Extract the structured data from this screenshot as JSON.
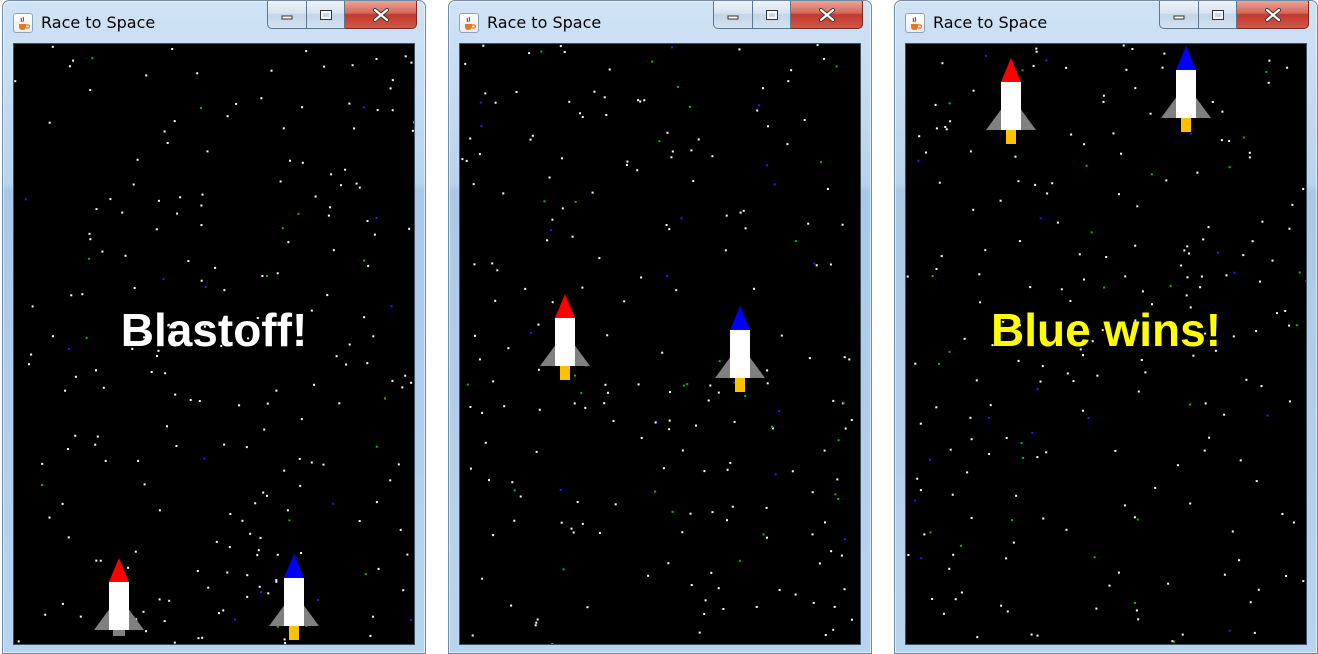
{
  "colors": {
    "red_rocket_nose": "#ff0000",
    "blue_rocket_nose": "#0000ff",
    "rocket_body": "#ffffff",
    "rocket_fins": "#808080",
    "flame": "#ffc000",
    "space": "#000000",
    "star_white": "#ffffff",
    "star_green": "#00c000",
    "star_blue": "#2020ff",
    "blastoff_text": "#ffffff",
    "winner_text": "#ffff00"
  },
  "windows": [
    {
      "title": "Race to Space",
      "message": "Blastoff!",
      "message_color": "#ffffff",
      "red_rocket": {
        "flame": false
      },
      "blue_rocket": {
        "flame": true
      }
    },
    {
      "title": "Race to Space",
      "message": "",
      "message_color": "#ffffff",
      "red_rocket": {
        "flame": true
      },
      "blue_rocket": {
        "flame": true
      }
    },
    {
      "title": "Race to Space",
      "message": "Blue wins!",
      "message_color": "#ffff00",
      "red_rocket": {
        "flame": true
      },
      "blue_rocket": {
        "flame": true
      }
    }
  ],
  "icons": {
    "app": "java-coffee-cup-icon",
    "minimize": "minimize-icon",
    "maximize": "maximize-icon",
    "close": "close-icon"
  }
}
